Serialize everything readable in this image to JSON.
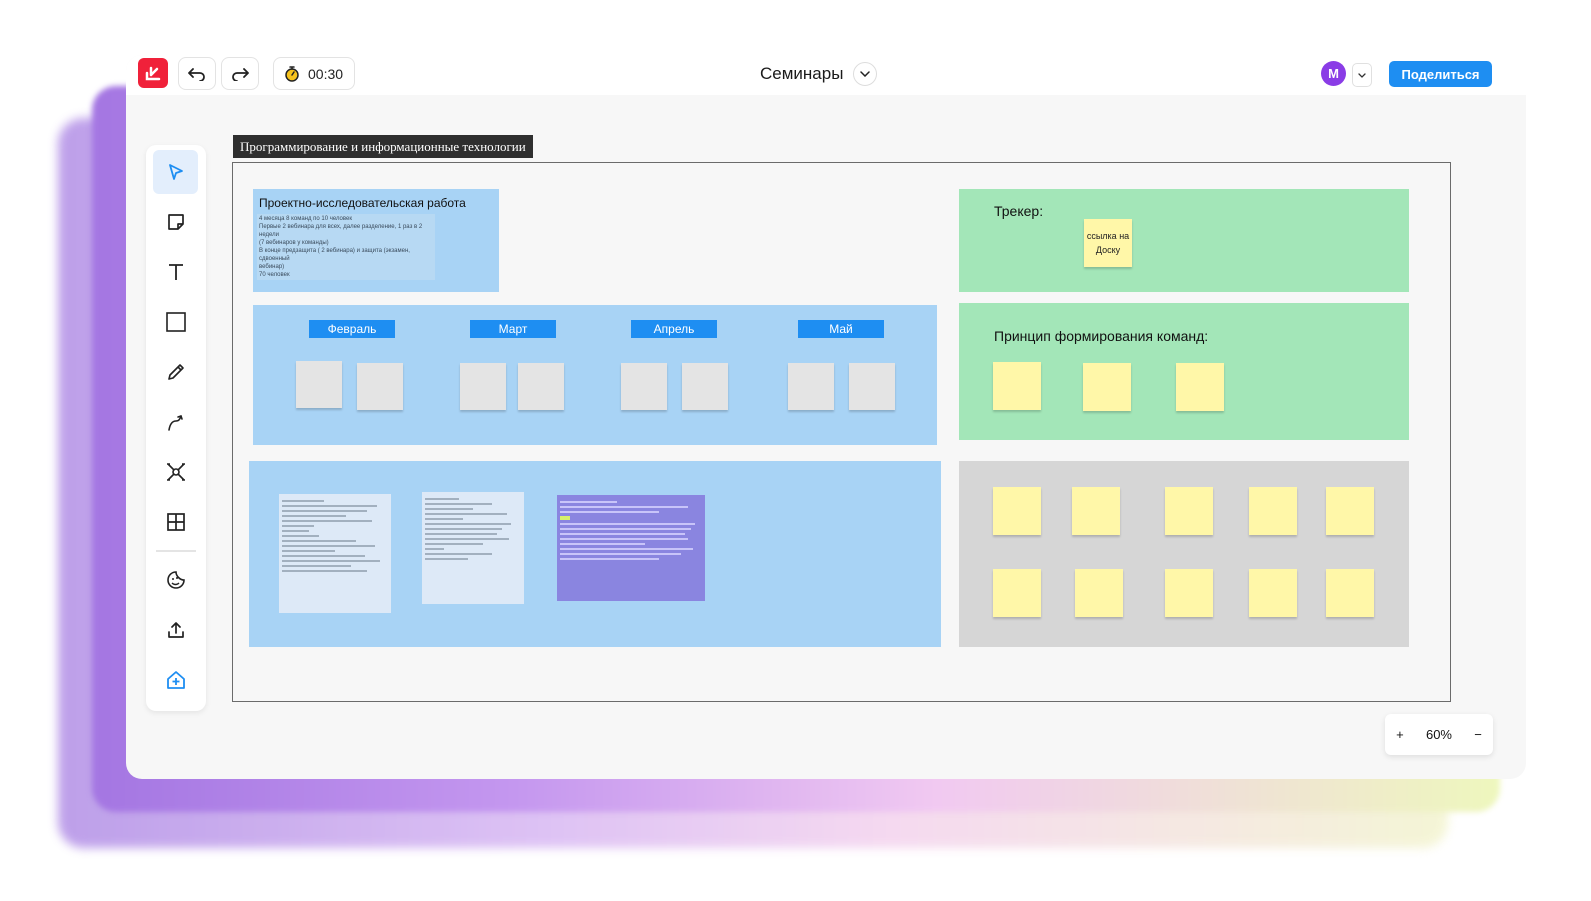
{
  "topbar": {
    "timer": "00:30",
    "board_title": "Семинары",
    "avatar_initial": "M",
    "share_label": "Поделиться"
  },
  "frame": {
    "label": "Программирование и информационные технологии"
  },
  "research": {
    "title": "Проектно-исследовательская работа",
    "lines": [
      "4 месяца 8 команд по 10 человек",
      "Первые 2 вебинара для всех, далее разделение, 1 раз в 2 недели",
      "(7 вебинаров у команды)",
      "В конце предзащита ( 2 вебинара) и защита (экзамен, сдвоенный",
      "вебинар)",
      "70 человек"
    ]
  },
  "months": [
    "Февраль",
    "Март",
    "Апрель",
    "Май"
  ],
  "tracker": {
    "title": "Трекер:",
    "link_note": "ссылка на Доску"
  },
  "teams": {
    "title": "Принцип формирования команд:"
  },
  "zoom": {
    "plus": "+",
    "level": "60%",
    "minus": "−"
  },
  "colors": {
    "accent": "#1e8ef2",
    "logo": "#f0213a",
    "blue_panel": "#a8d3f5",
    "green_panel": "#a3e6b8",
    "gray_panel": "#d6d6d6",
    "sticky_yellow": "#fff7a8",
    "sticky_gray": "#e4e4e4"
  }
}
